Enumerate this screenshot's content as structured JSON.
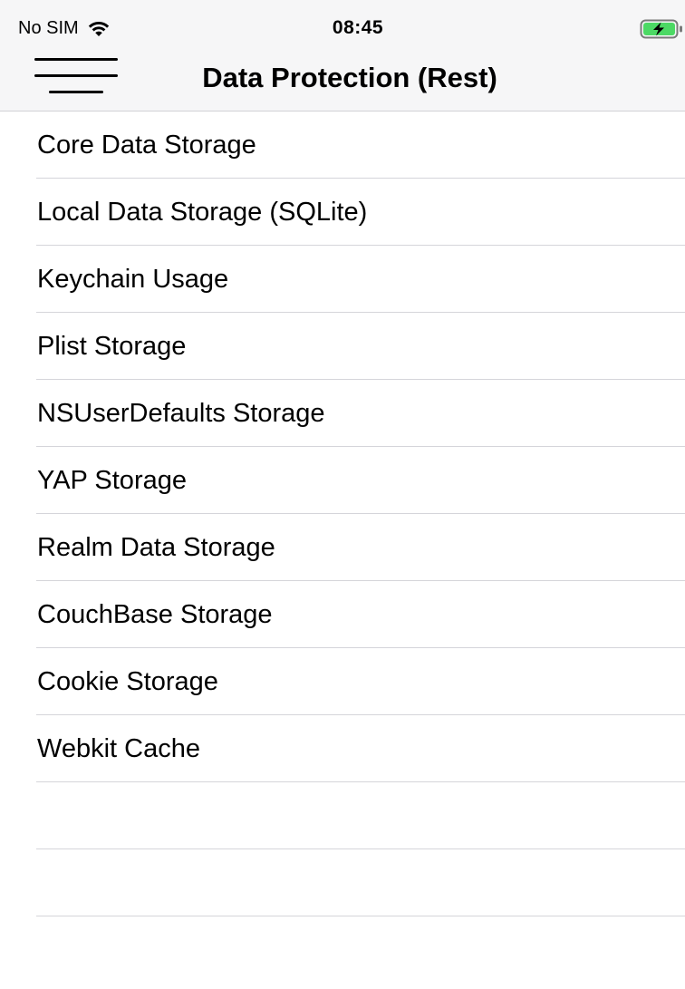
{
  "status_bar": {
    "carrier": "No SIM",
    "time": "08:45",
    "wifi_icon": "wifi-icon",
    "battery_icon": "battery-charging-icon",
    "battery_color": "#4cd964"
  },
  "nav_bar": {
    "menu_icon": "hamburger-menu-icon",
    "title": "Data Protection (Rest)"
  },
  "list": {
    "items": [
      {
        "label": "Core Data Storage"
      },
      {
        "label": "Local Data Storage (SQLite)"
      },
      {
        "label": "Keychain Usage"
      },
      {
        "label": "Plist Storage"
      },
      {
        "label": "NSUserDefaults Storage"
      },
      {
        "label": "YAP Storage"
      },
      {
        "label": "Realm Data Storage"
      },
      {
        "label": "CouchBase Storage"
      },
      {
        "label": "Cookie Storage"
      },
      {
        "label": "Webkit Cache"
      }
    ],
    "empty_rows": 2
  },
  "colors": {
    "nav_background": "#f6f6f7",
    "separator": "#d5d5da",
    "text": "#000000"
  }
}
